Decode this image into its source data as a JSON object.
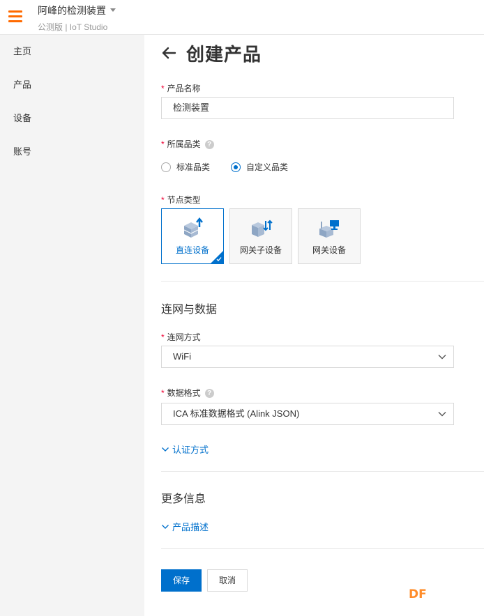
{
  "header": {
    "app_title": "阿峰的检测装置",
    "app_subtitle": "公测版 | IoT Studio"
  },
  "sidebar": {
    "items": [
      {
        "label": "主页"
      },
      {
        "label": "产品"
      },
      {
        "label": "设备"
      },
      {
        "label": "账号"
      }
    ]
  },
  "page": {
    "title": "创建产品"
  },
  "form": {
    "product_name": {
      "label": "产品名称",
      "value": "检测装置"
    },
    "category": {
      "label": "所属品类",
      "options": [
        {
          "label": "标准品类",
          "checked": false
        },
        {
          "label": "自定义品类",
          "checked": true
        }
      ]
    },
    "node_type": {
      "label": "节点类型",
      "options": [
        {
          "label": "直连设备",
          "selected": true,
          "icon": "direct-device-icon"
        },
        {
          "label": "网关子设备",
          "selected": false,
          "icon": "gateway-subdevice-icon"
        },
        {
          "label": "网关设备",
          "selected": false,
          "icon": "gateway-device-icon"
        }
      ]
    },
    "network_section_title": "连网与数据",
    "network_method": {
      "label": "连网方式",
      "value": "WiFi"
    },
    "data_format": {
      "label": "数据格式",
      "value": "ICA 标准数据格式 (Alink JSON)"
    },
    "auth_expander": "认证方式",
    "more_section_title": "更多信息",
    "desc_expander": "产品描述",
    "help_glyph": "?",
    "required_mark": "*"
  },
  "actions": {
    "save_label": "保存",
    "cancel_label": "取消"
  },
  "watermark": "DF",
  "colors": {
    "accent": "#0070cc",
    "brand_orange": "#ff6a00",
    "required": "#ee0033"
  }
}
